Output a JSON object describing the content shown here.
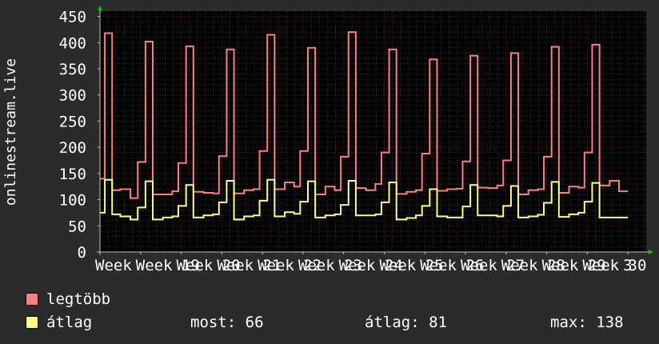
{
  "chart_data": {
    "type": "line",
    "ylabel": "onlinestream.live",
    "yticks": [
      "0",
      "50",
      "100",
      "150",
      "200",
      "250",
      "300",
      "350",
      "400",
      "450"
    ],
    "ylim": [
      0,
      460
    ],
    "xlim": [
      0,
      13.45
    ],
    "xticks": [
      {
        "x": 0,
        "label": "Week"
      },
      {
        "x": 1,
        "label": "Week 19"
      },
      {
        "x": 2,
        "label": "Week 20"
      },
      {
        "x": 3,
        "label": "Week 21"
      },
      {
        "x": 4,
        "label": "Week 22"
      },
      {
        "x": 5,
        "label": "Week 23"
      },
      {
        "x": 6,
        "label": "Week 24"
      },
      {
        "x": 7,
        "label": "Week 25"
      },
      {
        "x": 8,
        "label": "Week 26"
      },
      {
        "x": 9,
        "label": "Week 27"
      },
      {
        "x": 10,
        "label": "Week 28"
      },
      {
        "x": 11,
        "label": "Week 29"
      },
      {
        "x": 12,
        "label": "Week 30"
      },
      {
        "x": 13,
        "label": "3"
      }
    ],
    "series": [
      {
        "name": "legtöbb",
        "color": "#ff7f7f",
        "points": [
          [
            0,
            140
          ],
          [
            0.12,
            418
          ],
          [
            0.3,
            118
          ],
          [
            0.5,
            120
          ],
          [
            0.75,
            103
          ],
          [
            0.93,
            172
          ],
          [
            1.12,
            402
          ],
          [
            1.3,
            110
          ],
          [
            1.55,
            110
          ],
          [
            1.78,
            116
          ],
          [
            1.93,
            170
          ],
          [
            2.12,
            393
          ],
          [
            2.3,
            115
          ],
          [
            2.55,
            113
          ],
          [
            2.78,
            112
          ],
          [
            2.93,
            183
          ],
          [
            3.12,
            387
          ],
          [
            3.3,
            112
          ],
          [
            3.55,
            118
          ],
          [
            3.78,
            120
          ],
          [
            3.93,
            193
          ],
          [
            4.12,
            415
          ],
          [
            4.3,
            120
          ],
          [
            4.55,
            133
          ],
          [
            4.78,
            125
          ],
          [
            4.93,
            193
          ],
          [
            5.12,
            390
          ],
          [
            5.3,
            110
          ],
          [
            5.55,
            125
          ],
          [
            5.78,
            118
          ],
          [
            5.93,
            182
          ],
          [
            6.12,
            420
          ],
          [
            6.3,
            122
          ],
          [
            6.55,
            118
          ],
          [
            6.78,
            130
          ],
          [
            6.93,
            190
          ],
          [
            7.12,
            387
          ],
          [
            7.3,
            111
          ],
          [
            7.55,
            115
          ],
          [
            7.78,
            118
          ],
          [
            7.93,
            188
          ],
          [
            8.12,
            368
          ],
          [
            8.3,
            117
          ],
          [
            8.55,
            120
          ],
          [
            8.78,
            121
          ],
          [
            8.93,
            173
          ],
          [
            9.12,
            375
          ],
          [
            9.3,
            123
          ],
          [
            9.55,
            122
          ],
          [
            9.78,
            127
          ],
          [
            9.93,
            175
          ],
          [
            10.12,
            380
          ],
          [
            10.3,
            110
          ],
          [
            10.55,
            118
          ],
          [
            10.78,
            120
          ],
          [
            10.93,
            182
          ],
          [
            11.12,
            392
          ],
          [
            11.3,
            113
          ],
          [
            11.55,
            125
          ],
          [
            11.78,
            123
          ],
          [
            11.93,
            190
          ],
          [
            12.12,
            396
          ],
          [
            12.3,
            127
          ],
          [
            12.55,
            136
          ],
          [
            12.78,
            116
          ],
          [
            13.0,
            116
          ]
        ]
      },
      {
        "name": "átlag",
        "color": "#ffff7f",
        "points": [
          [
            0,
            75
          ],
          [
            0.12,
            138
          ],
          [
            0.3,
            72
          ],
          [
            0.5,
            68
          ],
          [
            0.75,
            62
          ],
          [
            0.93,
            85
          ],
          [
            1.12,
            135
          ],
          [
            1.3,
            62
          ],
          [
            1.55,
            66
          ],
          [
            1.78,
            68
          ],
          [
            1.93,
            88
          ],
          [
            2.12,
            128
          ],
          [
            2.3,
            66
          ],
          [
            2.55,
            70
          ],
          [
            2.78,
            72
          ],
          [
            2.93,
            95
          ],
          [
            3.12,
            136
          ],
          [
            3.3,
            62
          ],
          [
            3.55,
            68
          ],
          [
            3.78,
            70
          ],
          [
            3.93,
            98
          ],
          [
            4.12,
            138
          ],
          [
            4.3,
            68
          ],
          [
            4.55,
            76
          ],
          [
            4.78,
            73
          ],
          [
            4.93,
            96
          ],
          [
            5.12,
            135
          ],
          [
            5.3,
            66
          ],
          [
            5.55,
            70
          ],
          [
            5.78,
            72
          ],
          [
            5.93,
            90
          ],
          [
            6.12,
            136
          ],
          [
            6.3,
            70
          ],
          [
            6.55,
            70
          ],
          [
            6.78,
            72
          ],
          [
            6.93,
            95
          ],
          [
            7.12,
            133
          ],
          [
            7.3,
            62
          ],
          [
            7.55,
            65
          ],
          [
            7.78,
            70
          ],
          [
            7.93,
            88
          ],
          [
            8.12,
            120
          ],
          [
            8.3,
            68
          ],
          [
            8.55,
            66
          ],
          [
            8.78,
            66
          ],
          [
            8.93,
            87
          ],
          [
            9.12,
            128
          ],
          [
            9.3,
            70
          ],
          [
            9.55,
            70
          ],
          [
            9.78,
            68
          ],
          [
            9.93,
            88
          ],
          [
            10.12,
            126
          ],
          [
            10.3,
            66
          ],
          [
            10.55,
            68
          ],
          [
            10.78,
            71
          ],
          [
            10.93,
            94
          ],
          [
            11.12,
            134
          ],
          [
            11.3,
            67
          ],
          [
            11.55,
            72
          ],
          [
            11.78,
            75
          ],
          [
            11.93,
            96
          ],
          [
            12.12,
            132
          ],
          [
            12.3,
            66
          ],
          [
            12.55,
            66
          ],
          [
            12.78,
            66
          ],
          [
            13.0,
            66
          ]
        ]
      }
    ]
  },
  "legend": {
    "max_series": {
      "label": "legtöbb",
      "color": "#ff7f7f"
    },
    "avg_series": {
      "label": "átlag",
      "color": "#ffff7f"
    }
  },
  "stats": {
    "current": "most: 66",
    "average": "átlag: 81",
    "maximum": "max: 138"
  }
}
